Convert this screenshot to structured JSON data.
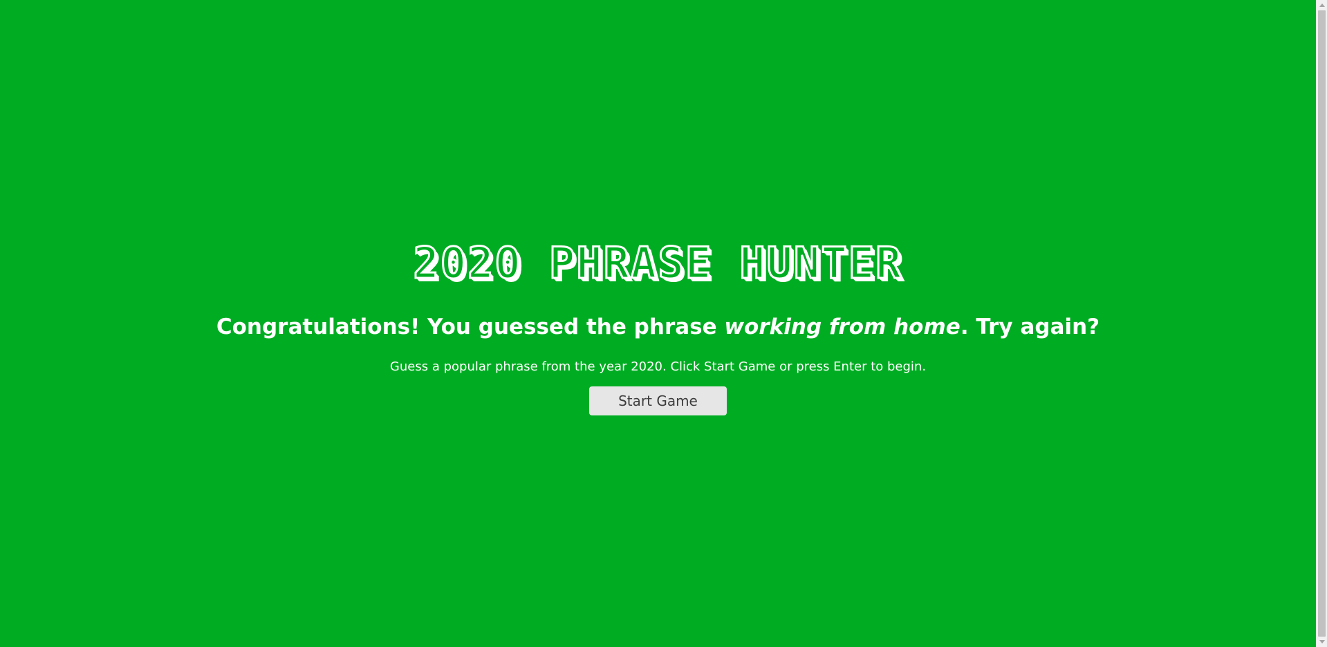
{
  "app": {
    "title": "2020 PHRASE HUNTER"
  },
  "overlay": {
    "message_prefix": "Congratulations! You guessed the phrase ",
    "message_phrase": "working from home",
    "message_suffix": ". Try again?",
    "instructions": "Guess a popular phrase from the year 2020. Click Start Game or press Enter to begin.",
    "start_button_label": "Start Game"
  },
  "colors": {
    "background": "#00ad22",
    "text": "#ffffff",
    "button_bg": "#e6e6e6",
    "button_text": "#3d3d3d"
  },
  "scrollbar": {
    "up_icon": "scroll-up-arrow",
    "down_icon": "scroll-down-arrow"
  }
}
